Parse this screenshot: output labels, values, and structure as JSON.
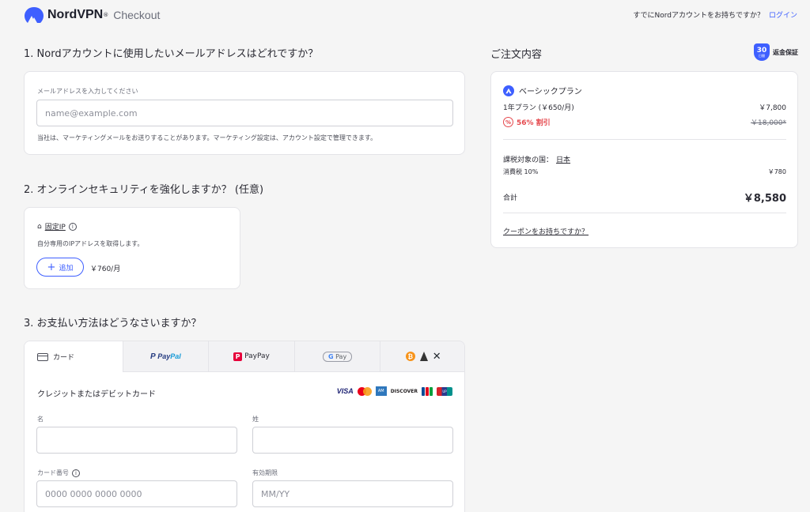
{
  "header": {
    "brand": "NordVPN",
    "reg": "®",
    "checkout": "Checkout",
    "account_question": "すでにNordアカウントをお持ちですか？",
    "login": "ログイン"
  },
  "email_section": {
    "title": "1. Nordアカウントに使用したいメールアドレスはどれですか？",
    "label": "メールアドレスを入力してください",
    "placeholder": "name@example.com",
    "note": "当社は、マーケティングメールをお送りすることがあります。マーケティング設定は、アカウント設定で管理できます。"
  },
  "security_section": {
    "title": "2. オンラインセキュリティを強化しますか？ (任意)",
    "ip_title": "固定IP",
    "ip_desc": "自分専用のIPアドレスを取得します。",
    "add_label": "追加",
    "price": "￥760/月"
  },
  "payment_section": {
    "title": "3. お支払い方法はどうなさいますか？",
    "tabs": {
      "card": "カード",
      "paypal_a": "Pay",
      "paypal_b": "Pal",
      "paypay": "PayPay",
      "gpay": "Pay"
    },
    "subtitle": "クレジットまたはデビットカード",
    "brands": {
      "visa": "VISA",
      "discover": "DISCOVER"
    },
    "first_name_label": "名",
    "last_name_label": "姓",
    "card_number_label": "カード番号",
    "card_number_placeholder": "0000 0000 0000 0000",
    "expiry_label": "有効期限",
    "expiry_placeholder": "MM/YY"
  },
  "order": {
    "title": "ご注文内容",
    "guarantee_days": "30",
    "guarantee_unit": "日間",
    "guarantee_text": "返金保証",
    "plan_name": "ベーシックプラン",
    "plan_term": "1年プラン (￥650/月)",
    "plan_price": "￥7,800",
    "discount_label": "56% 割引",
    "original_price": "￥18,000*",
    "tax_country_label": "課税対象の国：",
    "tax_country": "日本",
    "tax_label": "消費税 10%",
    "tax_amount": "￥780",
    "total_label": "合計",
    "total_amount": "￥8,580",
    "coupon": "クーポンをお持ちですか？"
  },
  "colors": {
    "accent": "#3e5fff",
    "discount": "#e5484d",
    "background": "#f5f5f5"
  }
}
